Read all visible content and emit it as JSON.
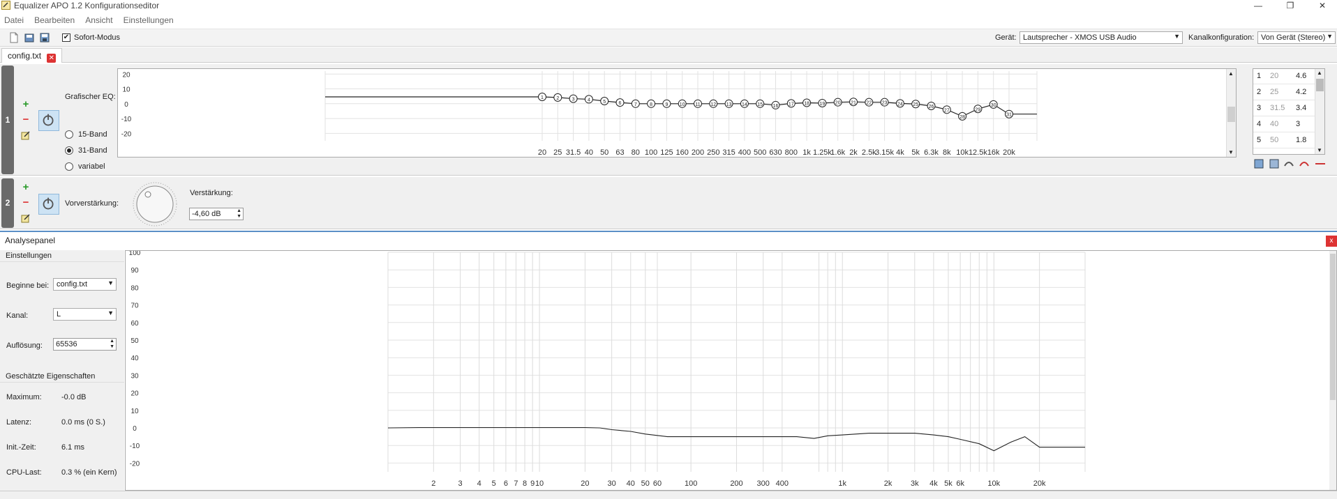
{
  "window": {
    "title": "Equalizer APO 1.2 Konfigurationseditor"
  },
  "menu": [
    "Datei",
    "Bearbeiten",
    "Ansicht",
    "Einstellungen"
  ],
  "toolbar": {
    "instant_mode_label": "Sofort-Modus",
    "instant_mode_checked": true,
    "device_label": "Gerät:",
    "device_value": "Lautsprecher - XMOS USB Audio",
    "channel_config_label": "Kanalkonfiguration:",
    "channel_config_value": "Von Gerät (Stereo)"
  },
  "tab": {
    "label": "config.txt"
  },
  "filter1": {
    "number": "1",
    "label": "Grafischer EQ:",
    "band_options": [
      "15-Band",
      "31-Band",
      "variabel"
    ],
    "selected_band_option": "31-Band",
    "chart_data": {
      "type": "line",
      "y_ticks": [
        "20",
        "10",
        "0",
        "-10",
        "-20"
      ],
      "ylim": [
        -25,
        22
      ],
      "x_labels": [
        "20",
        "25",
        "31.5",
        "40",
        "50",
        "63",
        "80",
        "100",
        "125",
        "160",
        "200",
        "250",
        "315",
        "400",
        "500",
        "630",
        "800",
        "1k",
        "1.25k",
        "1.6k",
        "2k",
        "2.5k",
        "3.15k",
        "4k",
        "5k",
        "6.3k",
        "8k",
        "10k",
        "12.5k",
        "16k",
        "20k"
      ],
      "gains": [
        4.6,
        4.2,
        3.4,
        3.0,
        1.8,
        0.8,
        0.0,
        0.0,
        0.0,
        0.0,
        0.0,
        0.0,
        0.0,
        0.0,
        0.0,
        -1.0,
        0.2,
        0.6,
        0.4,
        1.0,
        1.2,
        1.0,
        1.0,
        0.2,
        -0.2,
        -1.5,
        -4.0,
        -8.5,
        -3.5,
        -0.5,
        -7.0
      ],
      "point_labels": [
        "1",
        "2",
        "3",
        "4",
        "5",
        "6",
        "7",
        "8",
        "9",
        "10",
        "11",
        "12",
        "13",
        "14",
        "15",
        "16",
        "17",
        "18",
        "19",
        "20",
        "21",
        "22",
        "23",
        "24",
        "25",
        "26",
        "27",
        "28",
        "29",
        "30",
        "31"
      ],
      "flat_level_left": 4.6,
      "flat_level_right": -7.0
    },
    "bands": [
      {
        "index": "1",
        "freq": "20",
        "gain": "4.6"
      },
      {
        "index": "2",
        "freq": "25",
        "gain": "4.2"
      },
      {
        "index": "3",
        "freq": "31.5",
        "gain": "3.4"
      },
      {
        "index": "4",
        "freq": "40",
        "gain": "3"
      },
      {
        "index": "5",
        "freq": "50",
        "gain": "1.8"
      }
    ]
  },
  "filter2": {
    "number": "2",
    "label": "Vorverstärkung:",
    "gain_label": "Verstärkung:",
    "gain_value": "-4,60 dB"
  },
  "analysis": {
    "title": "Analysepanel",
    "settings_header": "Einstellungen",
    "start_label": "Beginne bei:",
    "start_value": "config.txt",
    "channel_label": "Kanal:",
    "channel_value": "L",
    "resolution_label": "Auflösung:",
    "resolution_value": "65536",
    "props_header": "Geschätzte Eigenschaften",
    "props": [
      {
        "label": "Maximum:",
        "value": "-0.0 dB"
      },
      {
        "label": "Latenz:",
        "value": "0.0 ms (0 S.)"
      },
      {
        "label": "Init.-Zeit:",
        "value": "6.1 ms"
      },
      {
        "label": "CPU-Last:",
        "value": "0.3 % (ein Kern)"
      }
    ],
    "chart_data": {
      "type": "line",
      "x_scale": "log",
      "xlim": [
        1,
        40000
      ],
      "ylim": [
        -25,
        100
      ],
      "y_ticks": [
        100,
        90,
        80,
        70,
        60,
        50,
        40,
        30,
        20,
        10,
        0,
        -10,
        -20
      ],
      "x_ticks": [
        {
          "value": 2,
          "label": "2"
        },
        {
          "value": 3,
          "label": "3"
        },
        {
          "value": 4,
          "label": "4"
        },
        {
          "value": 5,
          "label": "5"
        },
        {
          "value": 6,
          "label": "6"
        },
        {
          "value": 7,
          "label": "7"
        },
        {
          "value": 8,
          "label": "8"
        },
        {
          "value": 9,
          "label": "9"
        },
        {
          "value": 10,
          "label": "10"
        },
        {
          "value": 20,
          "label": "20"
        },
        {
          "value": 30,
          "label": "30"
        },
        {
          "value": 40,
          "label": "40"
        },
        {
          "value": 50,
          "label": "50"
        },
        {
          "value": 60,
          "label": "60"
        },
        {
          "value": 100,
          "label": "100"
        },
        {
          "value": 200,
          "label": "200"
        },
        {
          "value": 300,
          "label": "300"
        },
        {
          "value": 400,
          "label": "400"
        },
        {
          "value": 1000,
          "label": "1k"
        },
        {
          "value": 2000,
          "label": "2k"
        },
        {
          "value": 3000,
          "label": "3k"
        },
        {
          "value": 4000,
          "label": "4k"
        },
        {
          "value": 5000,
          "label": "5k"
        },
        {
          "value": 6000,
          "label": "6k"
        },
        {
          "value": 10000,
          "label": "10k"
        },
        {
          "value": 20000,
          "label": "20k"
        }
      ],
      "minor_ticks": [
        700,
        800,
        900,
        7000,
        8000,
        9000
      ],
      "series": [
        {
          "x": [
            1,
            1.6,
            5,
            12,
            20,
            25,
            30,
            40,
            50,
            70,
            100,
            200,
            500,
            650,
            800,
            1000,
            1500,
            2000,
            3000,
            4000,
            5000,
            6000,
            8000,
            10000,
            13000,
            16000,
            20000,
            30000,
            40000
          ],
          "y": [
            0,
            0.2,
            0.2,
            0.2,
            0.2,
            0,
            -1,
            -2,
            -3.5,
            -5,
            -5,
            -5,
            -5,
            -6,
            -4.5,
            -4,
            -3,
            -3,
            -3,
            -4,
            -5,
            -6.5,
            -9,
            -13,
            -8,
            -5,
            -11,
            -11,
            -11
          ]
        }
      ]
    }
  }
}
